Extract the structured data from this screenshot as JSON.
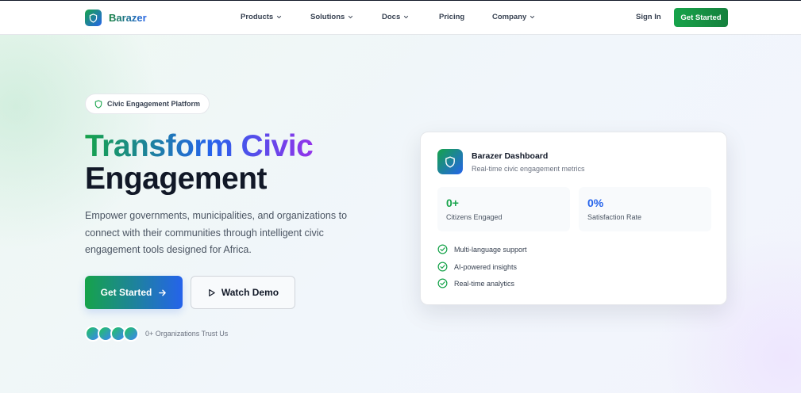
{
  "brand": {
    "name": "Barazer"
  },
  "nav": {
    "items": [
      {
        "label": "Products",
        "dropdown": true
      },
      {
        "label": "Solutions",
        "dropdown": true
      },
      {
        "label": "Docs",
        "dropdown": true
      },
      {
        "label": "Pricing",
        "dropdown": false
      },
      {
        "label": "Company",
        "dropdown": true
      }
    ],
    "signin_label": "Sign In",
    "cta_label": "Get Started"
  },
  "hero": {
    "badge": "Civic Engagement Platform",
    "title_gradient": "Transform Civic",
    "title_dark": "Engagement",
    "lead": "Empower governments, municipalities, and organizations to connect with their communities through intelligent civic engagement tools designed for Africa.",
    "primary_cta": "Get Started",
    "secondary_cta": "Watch Demo",
    "trust_text": "0+ Organizations Trust Us"
  },
  "dashboard": {
    "title": "Barazer Dashboard",
    "subtitle": "Real-time civic engagement metrics",
    "stats": [
      {
        "value": "0+",
        "label": "Citizens Engaged",
        "color": "#16a34a"
      },
      {
        "value": "0%",
        "label": "Satisfaction Rate",
        "color": "#2563eb"
      }
    ],
    "features": [
      "Multi-language support",
      "AI-powered insights",
      "Real-time analytics"
    ]
  },
  "colors": {
    "green": "#16a34a",
    "blue": "#2563eb",
    "purple": "#9333ea"
  }
}
